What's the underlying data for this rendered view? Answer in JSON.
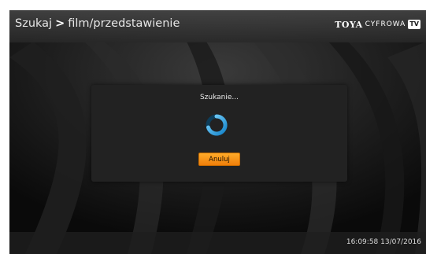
{
  "header": {
    "breadcrumb": [
      "Szukaj",
      "film/przedstawienie"
    ],
    "separator": ">",
    "logo": {
      "brand": "TOYA",
      "sub": "CYFROWA",
      "badge": "TV"
    }
  },
  "dialog": {
    "title": "Szukanie...",
    "cancel_label": "Anuluj",
    "spinner_icon": "loading-spinner-icon"
  },
  "footer": {
    "datetime": "16:09:58 13/07/2016"
  },
  "colors": {
    "accent": "#f59a1d",
    "spinner": "#2ab0e6",
    "dialog_bg": "#222222"
  }
}
